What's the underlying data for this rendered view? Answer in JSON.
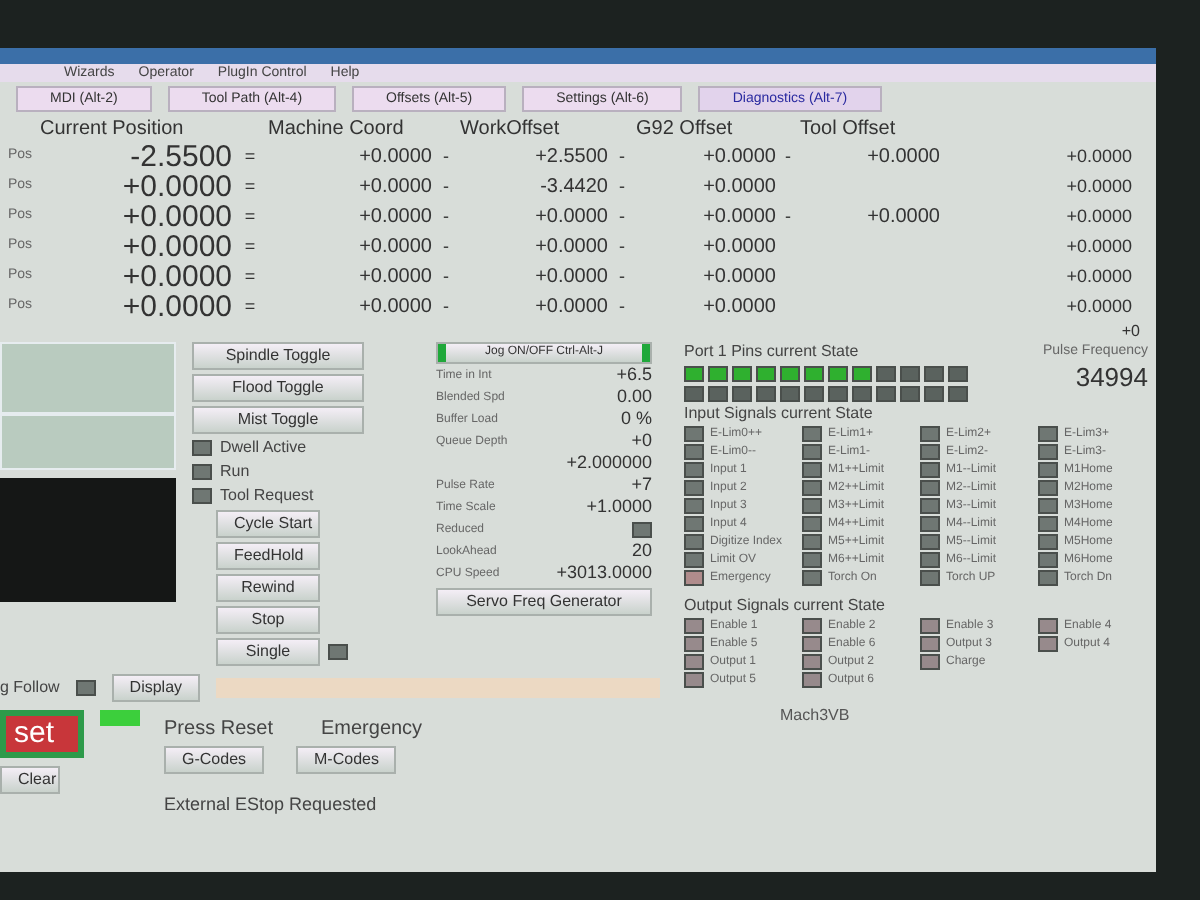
{
  "menu": [
    "Wizards",
    "Operator",
    "PlugIn Control",
    "Help"
  ],
  "tabs": [
    {
      "label": "MDI (Alt-2)",
      "selected": false
    },
    {
      "label": "Tool Path (Alt-4)",
      "selected": false
    },
    {
      "label": "Offsets (Alt-5)",
      "selected": false
    },
    {
      "label": "Settings (Alt-6)",
      "selected": false
    },
    {
      "label": "Diagnostics (Alt-7)",
      "selected": true
    }
  ],
  "dro": {
    "columns": [
      "Current Position",
      "Machine Coord",
      "WorkOffset",
      "G92 Offset",
      "Tool Offset"
    ],
    "rows": [
      {
        "axis": "Pos",
        "current": "-2.5500",
        "machine": "+0.0000",
        "work": "+2.5500",
        "g92": "+0.0000",
        "tool": "+0.0000",
        "extra": "+0.0000",
        "ops": [
          "=",
          "-",
          "-",
          "-"
        ]
      },
      {
        "axis": "Pos",
        "current": "+0.0000",
        "machine": "+0.0000",
        "work": "-3.4420",
        "g92": "+0.0000",
        "extra": "+0.0000",
        "ops": [
          "=",
          "-",
          "-"
        ]
      },
      {
        "axis": "Pos",
        "current": "+0.0000",
        "machine": "+0.0000",
        "work": "+0.0000",
        "g92": "+0.0000",
        "tool": "+0.0000",
        "extra": "+0.0000",
        "ops": [
          "=",
          "-",
          "-",
          "-"
        ]
      },
      {
        "axis": "Pos",
        "current": "+0.0000",
        "machine": "+0.0000",
        "work": "+0.0000",
        "g92": "+0.0000",
        "extra": "+0.0000",
        "ops": [
          "=",
          "-",
          "-"
        ]
      },
      {
        "axis": "Pos",
        "current": "+0.0000",
        "machine": "+0.0000",
        "work": "+0.0000",
        "g92": "+0.0000",
        "extra": "+0.0000",
        "ops": [
          "=",
          "-",
          "-"
        ]
      },
      {
        "axis": "Pos",
        "current": "+0.0000",
        "machine": "+0.0000",
        "work": "+0.0000",
        "g92": "+0.0000",
        "extra": "+0.0000",
        "ops": [
          "=",
          "-",
          "-"
        ]
      }
    ],
    "extra_footer": "+0"
  },
  "toggles": [
    "Spindle Toggle",
    "Flood Toggle",
    "Mist Toggle"
  ],
  "status_leds": [
    {
      "label": "Dwell Active",
      "on": false
    },
    {
      "label": "Run",
      "on": false
    },
    {
      "label": "Tool Request",
      "on": false
    }
  ],
  "cycle_buttons": [
    {
      "label": "Cycle Start"
    },
    {
      "label": "FeedHold"
    },
    {
      "label": "Rewind"
    },
    {
      "label": "Stop"
    },
    {
      "label": "Single",
      "led_on": false
    }
  ],
  "jog_button": {
    "label": "Jog ON/OFF Ctrl-Alt-J",
    "on": true
  },
  "stats": [
    {
      "label": "Time in Int",
      "value": "+6.5"
    },
    {
      "label": "Blended Spd",
      "value": "0.00"
    },
    {
      "label": "Buffer Load",
      "value": "0 %"
    },
    {
      "label": "Queue Depth",
      "value": "+0"
    },
    {
      "value": "+2.000000"
    },
    {
      "label": "Pulse Rate",
      "value": "+7"
    },
    {
      "label": "Time Scale",
      "value": "+1.0000"
    },
    {
      "label": "Reduced",
      "led_on": false
    },
    {
      "label": "LookAhead",
      "value": "20"
    },
    {
      "label": "CPU Speed",
      "value": "+3013.0000"
    }
  ],
  "servo_button": "Servo Freq Generator",
  "port": {
    "title": "Port 1 Pins current State",
    "rows": [
      [
        true,
        true,
        true,
        true,
        true,
        true,
        true,
        true,
        false,
        false,
        false,
        false
      ],
      [
        false,
        false,
        false,
        false,
        false,
        false,
        false,
        false,
        false,
        false,
        false,
        false
      ]
    ]
  },
  "pulse": {
    "label": "Pulse Frequency",
    "value": "34994"
  },
  "inputs": {
    "title": "Input Signals current State",
    "columns": [
      [
        {
          "label": "E-Lim0++",
          "on": false
        },
        {
          "label": "E-Lim0--",
          "on": false
        },
        {
          "label": "Input 1",
          "on": false
        },
        {
          "label": "Input 2",
          "on": false
        },
        {
          "label": "Input 3",
          "on": false
        },
        {
          "label": "Input 4",
          "on": false
        },
        {
          "label": "Digitize Index",
          "on": false
        },
        {
          "label": "Limit OV",
          "on": false
        },
        {
          "label": "Emergency",
          "on": true
        }
      ],
      [
        {
          "label": "E-Lim1+",
          "on": false
        },
        {
          "label": "E-Lim1-",
          "on": false
        },
        {
          "label": "M1++Limit",
          "on": false
        },
        {
          "label": "M2++Limit",
          "on": false
        },
        {
          "label": "M3++Limit",
          "on": false
        },
        {
          "label": "M4++Limit",
          "on": false
        },
        {
          "label": "M5++Limit",
          "on": false
        },
        {
          "label": "M6++Limit",
          "on": false
        },
        {
          "label": "Torch On",
          "on": false
        }
      ],
      [
        {
          "label": "E-Lim2+",
          "on": false
        },
        {
          "label": "E-Lim2-",
          "on": false
        },
        {
          "label": "M1--Limit",
          "on": false
        },
        {
          "label": "M2--Limit",
          "on": false
        },
        {
          "label": "M3--Limit",
          "on": false
        },
        {
          "label": "M4--Limit",
          "on": false
        },
        {
          "label": "M5--Limit",
          "on": false
        },
        {
          "label": "M6--Limit",
          "on": false
        },
        {
          "label": "Torch UP",
          "on": false
        }
      ],
      [
        {
          "label": "E-Lim3+",
          "on": false
        },
        {
          "label": "E-Lim3-",
          "on": false
        },
        {
          "label": "M1Home",
          "on": false
        },
        {
          "label": "M2Home",
          "on": false
        },
        {
          "label": "M3Home",
          "on": false
        },
        {
          "label": "M4Home",
          "on": false
        },
        {
          "label": "M5Home",
          "on": false
        },
        {
          "label": "M6Home",
          "on": false
        },
        {
          "label": "Torch Dn",
          "on": false
        }
      ]
    ]
  },
  "outputs": {
    "title": "Output Signals current State",
    "columns": [
      [
        {
          "label": "Enable 1",
          "on": true
        },
        {
          "label": "Enable 5",
          "on": true
        },
        {
          "label": "Output 1",
          "on": true
        },
        {
          "label": "Output 5",
          "on": true
        }
      ],
      [
        {
          "label": "Enable 2",
          "on": true
        },
        {
          "label": "Enable 6",
          "on": true
        },
        {
          "label": "Output 2",
          "on": true
        },
        {
          "label": "Output 6",
          "on": true
        }
      ],
      [
        {
          "label": "Enable 3",
          "on": true
        },
        {
          "label": "Output 3",
          "on": true
        },
        {
          "label": "Charge",
          "on": true
        }
      ],
      [
        {
          "label": "Enable 4",
          "on": true
        },
        {
          "label": "Output 4",
          "on": true
        }
      ]
    ]
  },
  "plugin_label": "Mach3VB",
  "follow": {
    "label": "g Follow",
    "led_on": false,
    "display_button": "Display"
  },
  "reset": {
    "label": "set",
    "led_on": true
  },
  "messages": {
    "press_reset": "Press Reset",
    "emergency": "Emergency",
    "estop": "External EStop Requested"
  },
  "code_buttons": [
    "G-Codes",
    "M-Codes"
  ],
  "clear_button": "Clear"
}
